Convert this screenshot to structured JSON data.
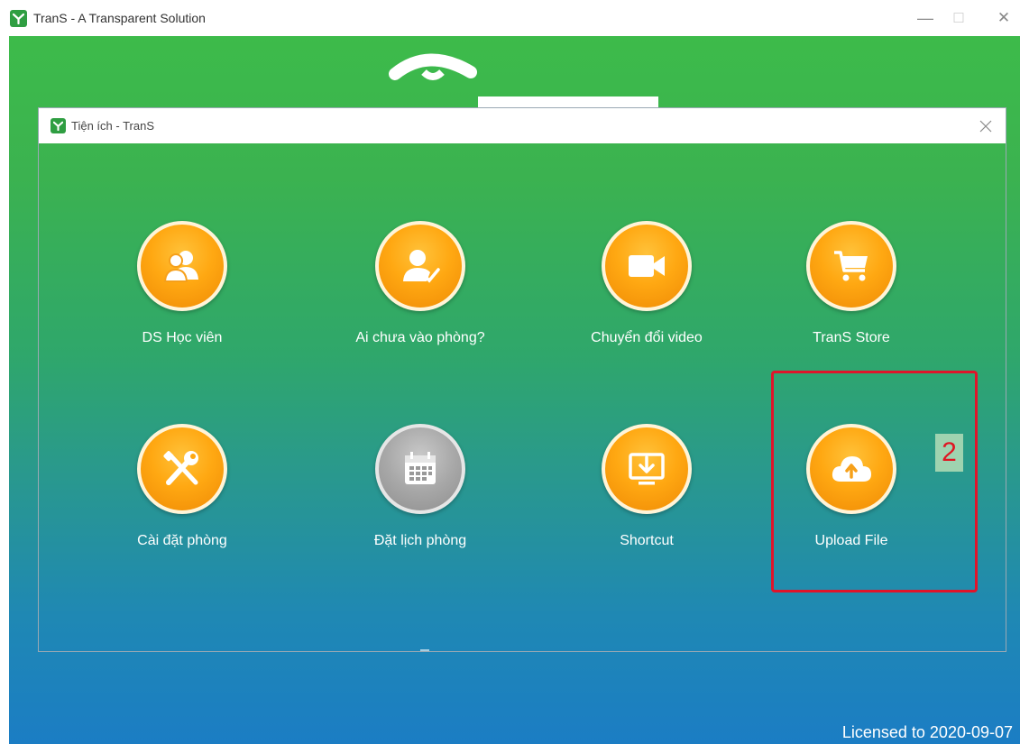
{
  "window": {
    "title": "TranS - A Transparent Solution",
    "minimize_label": "—",
    "maximize_label": "☐",
    "close_label": "✕"
  },
  "dialog": {
    "title": "Tiện ích - TranS",
    "close_label": "✕"
  },
  "tiles": [
    {
      "label": "DS Học viên",
      "icon": "users-icon"
    },
    {
      "label": "Ai chưa vào phòng?",
      "icon": "user-check-icon"
    },
    {
      "label": "Chuyển đổi video",
      "icon": "video-camera-icon"
    },
    {
      "label": "TranS Store",
      "icon": "shopping-cart-icon"
    },
    {
      "label": "Cài đặt phòng",
      "icon": "tools-icon"
    },
    {
      "label": "Đặt lịch phòng",
      "icon": "calendar-icon",
      "disabled": true
    },
    {
      "label": "Shortcut",
      "icon": "desktop-download-icon"
    },
    {
      "label": "Upload File",
      "icon": "cloud-upload-icon"
    }
  ],
  "annotation": {
    "badge_text": "2",
    "highlight_color": "#e0142a"
  },
  "footer": {
    "license_text": "Licensed to 2020-09-07"
  },
  "colors": {
    "green": "#3dbb4a",
    "blue": "#1b7dc4",
    "orange": "#ffa812"
  }
}
